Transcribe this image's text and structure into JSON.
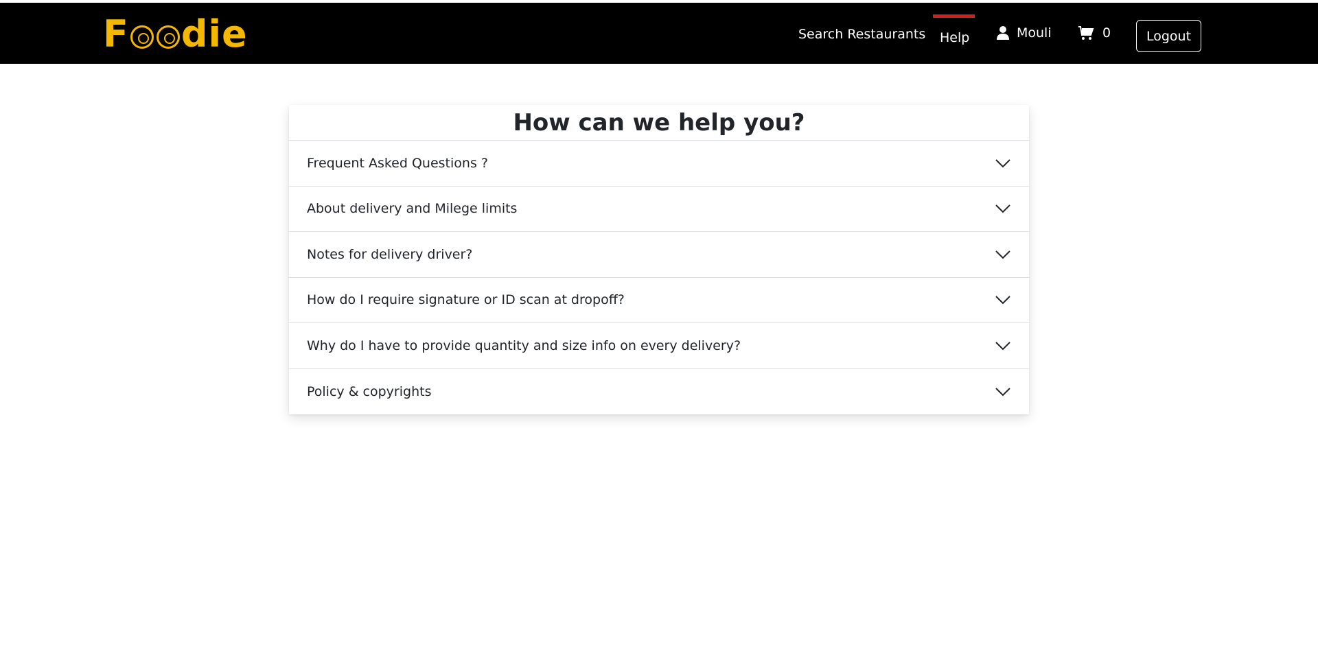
{
  "header": {
    "logo_text_left": "F",
    "logo_text_right": "die",
    "nav": {
      "search": "Search Restaurants",
      "help": "Help",
      "user": "Mouli",
      "cart_count": "0",
      "logout": "Logout"
    },
    "active_indicator_color": "#cc1f1f",
    "logo_color": "#f5b800",
    "icons": {
      "user": "user-icon",
      "cart": "cart-icon"
    }
  },
  "help": {
    "title": "How can we help you?",
    "items": [
      {
        "label": "Frequent Asked Questions ?"
      },
      {
        "label": "About delivery and Milege limits"
      },
      {
        "label": "Notes for delivery driver?"
      },
      {
        "label": "How do I require signature or ID scan at dropoff?"
      },
      {
        "label": "Why do I have to provide quantity and size info on every delivery?"
      },
      {
        "label": "Policy & copyrights"
      }
    ],
    "icon": "chevron-down-icon"
  }
}
